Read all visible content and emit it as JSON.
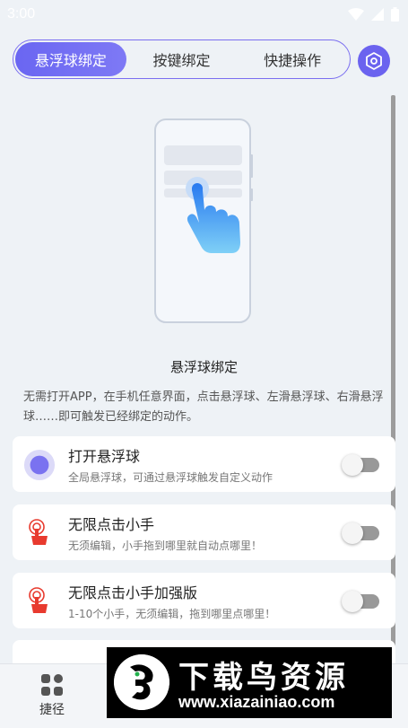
{
  "status_bar": {
    "time": "3:00"
  },
  "tabs": [
    {
      "label": "悬浮球绑定",
      "active": true
    },
    {
      "label": "按键绑定",
      "active": false
    },
    {
      "label": "快捷操作",
      "active": false
    }
  ],
  "section": {
    "title": "悬浮球绑定",
    "description": "无需打开APP，在手机任意界面，点击悬浮球、左滑悬浮球、右滑悬浮球……即可触发已经绑定的动作。"
  },
  "cards": [
    {
      "title": "打开悬浮球",
      "subtitle": "全局悬浮球，可通过悬浮球触发自定义动作",
      "icon": "floating-ball-icon",
      "enabled": false
    },
    {
      "title": "无限点击小手",
      "subtitle": "无须编辑，小手拖到哪里就自动点哪里！",
      "icon": "tap-hand-icon",
      "enabled": false
    },
    {
      "title": "无限点击小手加强版",
      "subtitle": "1-10个小手，无须编辑，拖到哪里点哪里！",
      "icon": "tap-hand-icon",
      "enabled": false
    }
  ],
  "bottom_nav": {
    "label": "捷径"
  },
  "watermark": {
    "title": "下载鸟资源",
    "url": "www.xiazainiao.com"
  },
  "colors": {
    "accent": "#6b63ef",
    "background": "#eef2f6",
    "red": "#e83a2e"
  }
}
